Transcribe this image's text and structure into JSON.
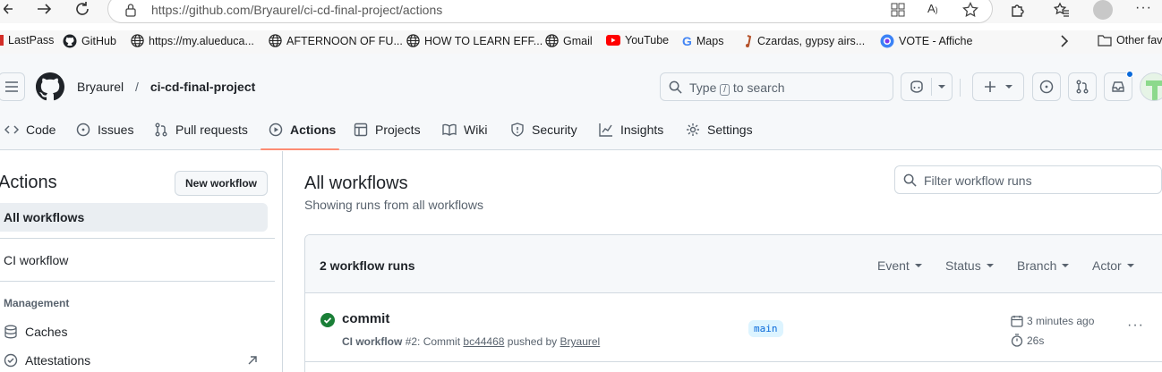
{
  "browser": {
    "url": "https://github.com/Bryaurel/ci-cd-final-project/actions",
    "bookmarks": [
      {
        "label": "LastPass",
        "icon": "lastpass-icon"
      },
      {
        "label": "GitHub",
        "icon": "github-icon"
      },
      {
        "label": "https://my.alueduca...",
        "icon": "globe-icon"
      },
      {
        "label": "AFTERNOON OF FU...",
        "icon": "globe-icon"
      },
      {
        "label": "HOW TO LEARN EFF...",
        "icon": "globe-icon"
      },
      {
        "label": "Gmail",
        "icon": "globe-icon"
      },
      {
        "label": "YouTube",
        "icon": "youtube-icon"
      },
      {
        "label": "Maps",
        "icon": "google-icon"
      },
      {
        "label": "Czardas, gypsy airs...",
        "icon": "music-icon"
      },
      {
        "label": "VOTE - Affiche",
        "icon": "vote-icon"
      }
    ],
    "other_favorites": "Other fav"
  },
  "repo": {
    "owner": "Bryaurel",
    "separator": "/",
    "name": "ci-cd-final-project"
  },
  "search": {
    "text_before": "Type",
    "key": "/",
    "text_after": "to search"
  },
  "tabs": [
    {
      "label": "Code",
      "icon": "code-icon"
    },
    {
      "label": "Issues",
      "icon": "issue-icon"
    },
    {
      "label": "Pull requests",
      "icon": "pull-request-icon"
    },
    {
      "label": "Actions",
      "icon": "play-icon",
      "active": true
    },
    {
      "label": "Projects",
      "icon": "table-icon"
    },
    {
      "label": "Wiki",
      "icon": "book-icon"
    },
    {
      "label": "Security",
      "icon": "shield-icon"
    },
    {
      "label": "Insights",
      "icon": "graph-icon"
    },
    {
      "label": "Settings",
      "icon": "gear-icon"
    }
  ],
  "sidebar": {
    "title": "Actions",
    "new_workflow": "New workflow",
    "all_workflows": "All workflows",
    "ci_workflow": "CI workflow",
    "management": "Management",
    "caches": "Caches",
    "attestations": "Attestations"
  },
  "main": {
    "title": "All workflows",
    "subtitle": "Showing runs from all workflows",
    "filter_placeholder": "Filter workflow runs",
    "runs_count": "2 workflow runs",
    "filters": [
      "Event",
      "Status",
      "Branch",
      "Actor"
    ]
  },
  "run": {
    "title": "commit",
    "workflow": "CI workflow",
    "number": "#2",
    "commit_prefix": ": Commit",
    "commit_sha": "bc44468",
    "pushed_by": "pushed by",
    "actor": "Bryaurel",
    "branch": "main",
    "time_ago": "3 minutes ago",
    "duration": "26s",
    "status": "success"
  },
  "colors": {
    "success": "#1a7f37",
    "active_tab_underline": "#fd8c73",
    "branch_bg": "#ddf4ff",
    "branch_text": "#0969da"
  }
}
